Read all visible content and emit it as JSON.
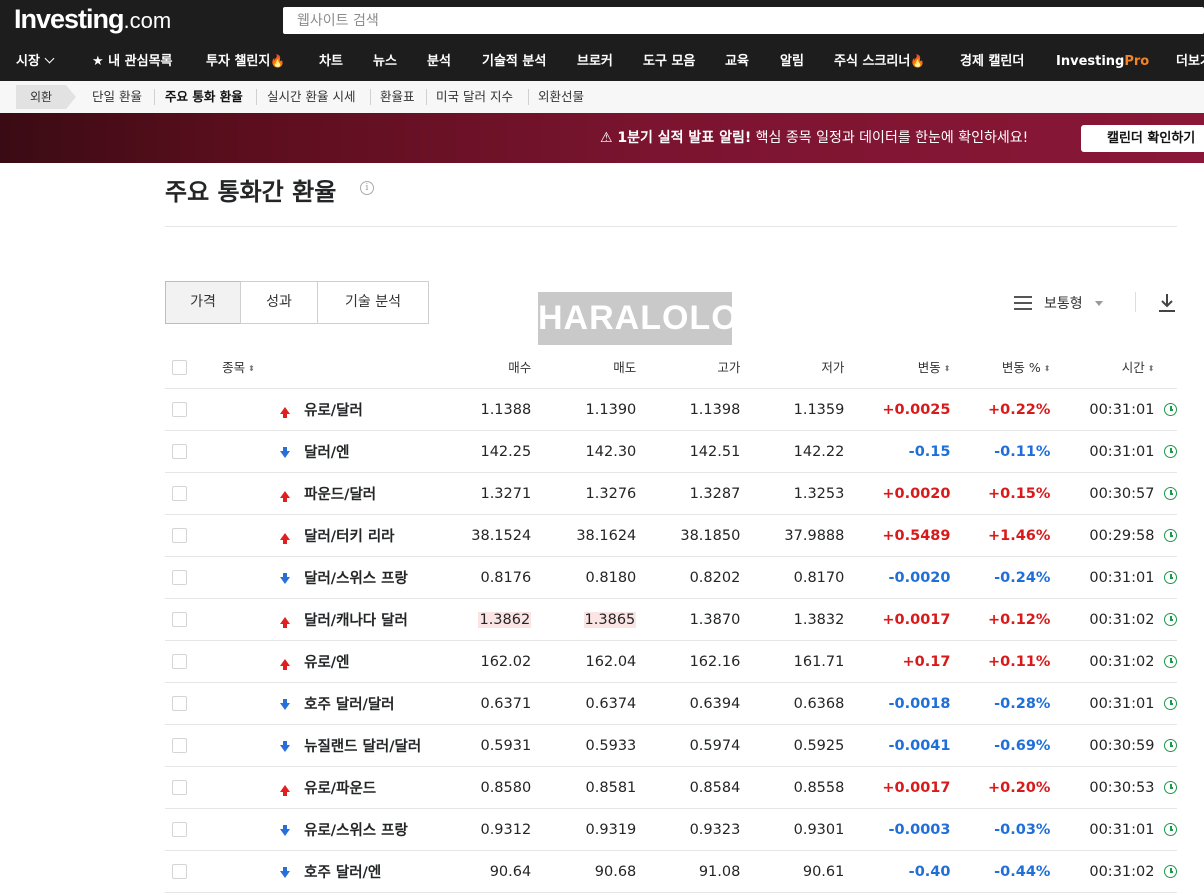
{
  "header": {
    "logo_main": "Investing",
    "logo_suffix": ".com",
    "search_placeholder": "웹사이트 검색"
  },
  "nav": {
    "items": [
      {
        "label": "시장"
      },
      {
        "label": "★ 내 관심목록"
      },
      {
        "label": "투자 챌린지"
      },
      {
        "label": "차트"
      },
      {
        "label": "뉴스"
      },
      {
        "label": "분석"
      },
      {
        "label": "기술적 분석"
      },
      {
        "label": "브로커"
      },
      {
        "label": "도구 모음"
      },
      {
        "label": "교육"
      },
      {
        "label": "알림"
      },
      {
        "label": "주식 스크리너"
      },
      {
        "label": "경제 캘린더"
      },
      {
        "label": "Investing"
      },
      {
        "label": "더보기"
      }
    ],
    "pro_suffix": "Pro",
    "flame_glyph": "🔥"
  },
  "subnav": {
    "crumb": "외환",
    "items": [
      "단일 환율",
      "주요 통화 환율",
      "실시간 환율 시세",
      "환율표",
      "미국 달러 지수",
      "외환선물"
    ]
  },
  "banner": {
    "title": "⚠ 1분기 실적 발표 알림!",
    "text": " 핵심 종목 일정과 데이터를 한눈에 확인하세요!",
    "button": "캘린더 확인하기"
  },
  "page": {
    "title": "주요 통화간 환율",
    "info_glyph": "i"
  },
  "tabs": [
    "가격",
    "성과",
    "기술 분석"
  ],
  "watermark": "HARALOLO",
  "view": {
    "label": "보통형"
  },
  "table": {
    "headers": {
      "name": "종목",
      "bid": "매수",
      "ask": "매도",
      "high": "고가",
      "low": "저가",
      "chg": "변동",
      "chg_pct": "변동 %",
      "time": "시간"
    },
    "sort_glyph": "⬍",
    "rows": [
      {
        "name": "유로/달러",
        "dir": "up",
        "bid": "1.1388",
        "ask": "1.1390",
        "high": "1.1398",
        "low": "1.1359",
        "chg": "+0.0025",
        "chg_pct": "+0.22%",
        "time": "00:31:01"
      },
      {
        "name": "달러/엔",
        "dir": "down",
        "bid": "142.25",
        "ask": "142.30",
        "high": "142.51",
        "low": "142.22",
        "chg": "-0.15",
        "chg_pct": "-0.11%",
        "time": "00:31:01"
      },
      {
        "name": "파운드/달러",
        "dir": "up",
        "bid": "1.3271",
        "ask": "1.3276",
        "high": "1.3287",
        "low": "1.3253",
        "chg": "+0.0020",
        "chg_pct": "+0.15%",
        "time": "00:30:57"
      },
      {
        "name": "달러/터키 리라",
        "dir": "up",
        "bid": "38.1524",
        "ask": "38.1624",
        "high": "38.1850",
        "low": "37.9888",
        "chg": "+0.5489",
        "chg_pct": "+1.46%",
        "time": "00:29:58"
      },
      {
        "name": "달러/스위스 프랑",
        "dir": "down",
        "bid": "0.8176",
        "ask": "0.8180",
        "high": "0.8202",
        "low": "0.8170",
        "chg": "-0.0020",
        "chg_pct": "-0.24%",
        "time": "00:31:01"
      },
      {
        "name": "달러/캐나다 달러",
        "dir": "up",
        "bid": "1.3862",
        "ask": "1.3865",
        "high": "1.3870",
        "low": "1.3832",
        "chg": "+0.0017",
        "chg_pct": "+0.12%",
        "time": "00:31:02"
      },
      {
        "name": "유로/엔",
        "dir": "up",
        "bid": "162.02",
        "ask": "162.04",
        "high": "162.16",
        "low": "161.71",
        "chg": "+0.17",
        "chg_pct": "+0.11%",
        "time": "00:31:02"
      },
      {
        "name": "호주 달러/달러",
        "dir": "down",
        "bid": "0.6371",
        "ask": "0.6374",
        "high": "0.6394",
        "low": "0.6368",
        "chg": "-0.0018",
        "chg_pct": "-0.28%",
        "time": "00:31:01"
      },
      {
        "name": "뉴질랜드 달러/달러",
        "dir": "down",
        "bid": "0.5931",
        "ask": "0.5933",
        "high": "0.5974",
        "low": "0.5925",
        "chg": "-0.0041",
        "chg_pct": "-0.69%",
        "time": "00:30:59"
      },
      {
        "name": "유로/파운드",
        "dir": "up",
        "bid": "0.8580",
        "ask": "0.8581",
        "high": "0.8584",
        "low": "0.8558",
        "chg": "+0.0017",
        "chg_pct": "+0.20%",
        "time": "00:30:53"
      },
      {
        "name": "유로/스위스 프랑",
        "dir": "down",
        "bid": "0.9312",
        "ask": "0.9319",
        "high": "0.9323",
        "low": "0.9301",
        "chg": "-0.0003",
        "chg_pct": "-0.03%",
        "time": "00:31:01"
      },
      {
        "name": "호주 달러/엔",
        "dir": "down",
        "bid": "90.64",
        "ask": "90.68",
        "high": "91.08",
        "low": "90.61",
        "chg": "-0.40",
        "chg_pct": "-0.44%",
        "time": "00:31:02"
      }
    ]
  },
  "colors": {
    "up": "#d91a1a",
    "down": "#1f6fd9",
    "banner": "#7b1430",
    "topbar": "#1d1d1d",
    "clock": "#1a9a4a"
  }
}
